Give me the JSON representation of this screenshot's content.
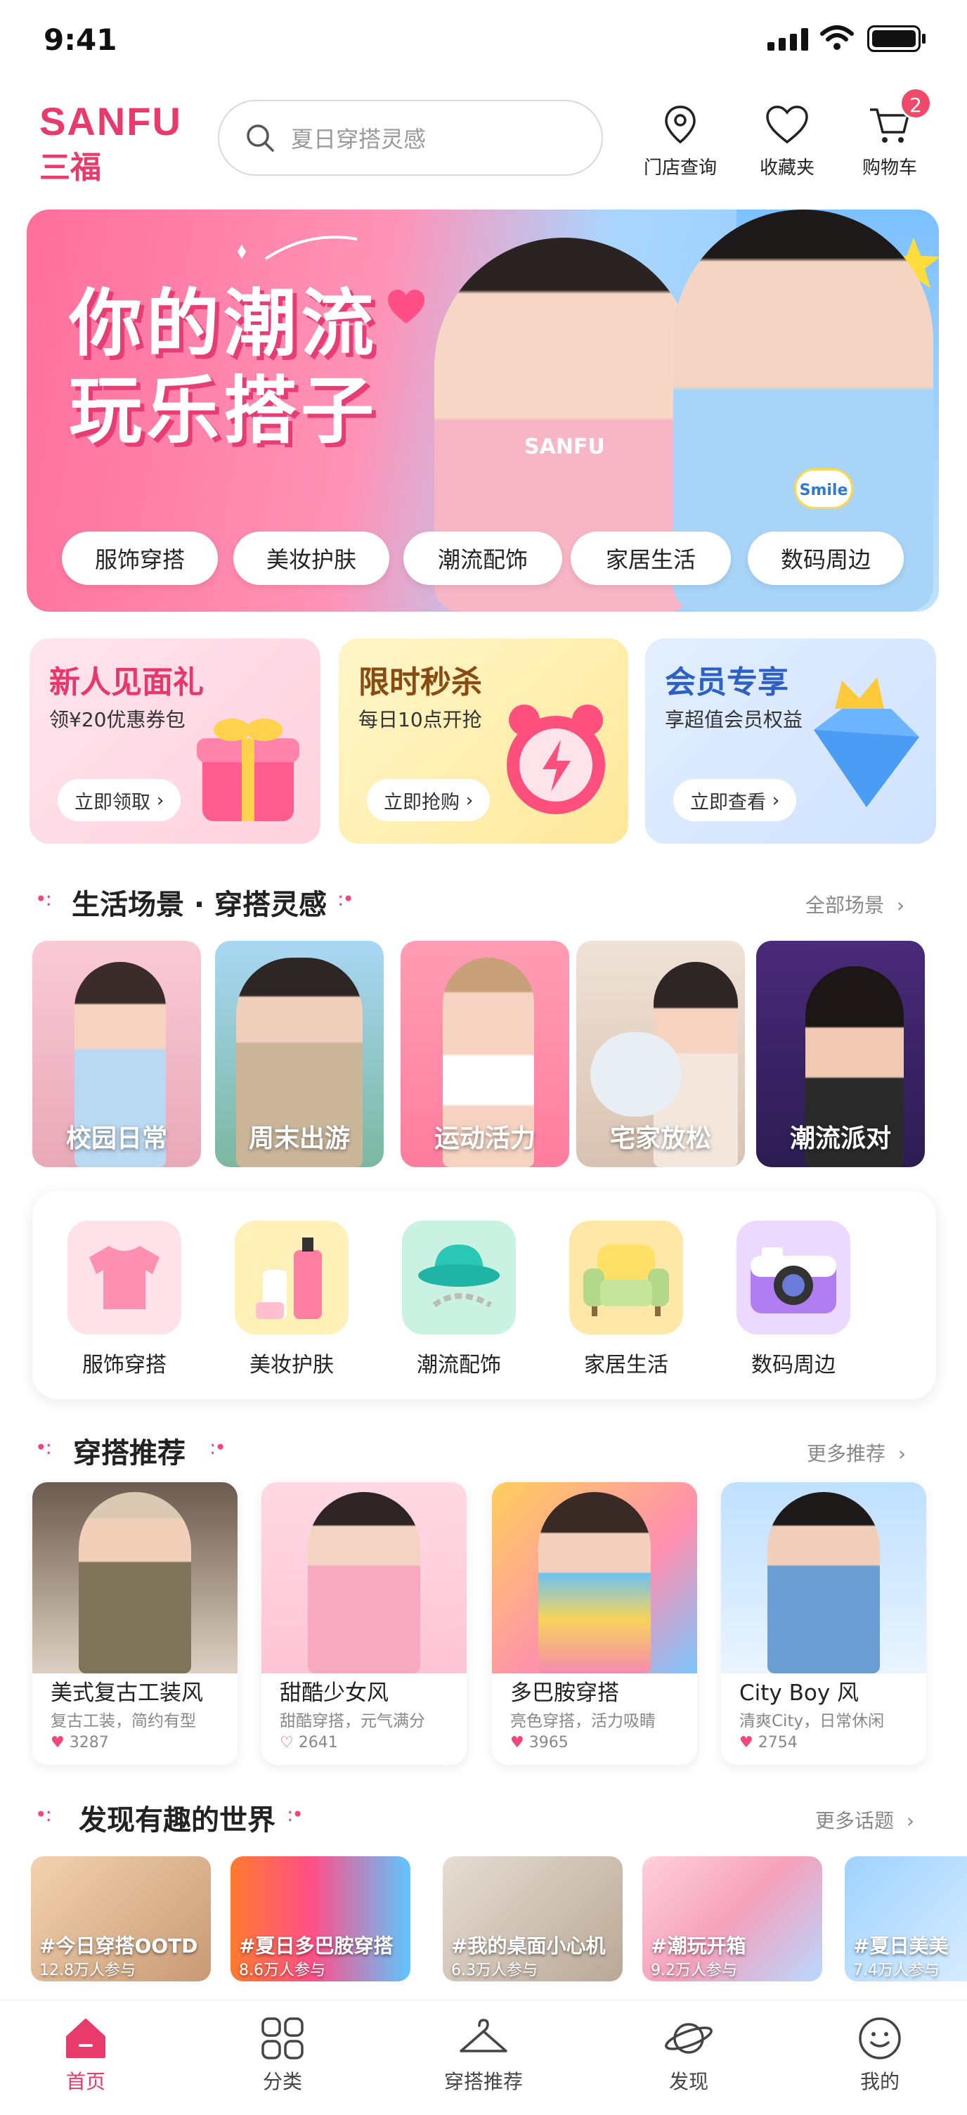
{
  "status": {
    "time": "9:41"
  },
  "header": {
    "logo_en": "SANFU",
    "logo_cn": "三福",
    "search_placeholder": "夏日穿搭灵感",
    "actions": [
      {
        "label": "门店查询",
        "icon": "location-pin-icon"
      },
      {
        "label": "收藏夹",
        "icon": "heart-icon"
      },
      {
        "label": "购物车",
        "icon": "cart-icon",
        "badge": "2"
      }
    ]
  },
  "banner": {
    "title_line1": "你的潮流",
    "title_line2": "玩乐搭子",
    "shirt_text": "SANFU",
    "badge_text": "Smile",
    "pills": [
      "服饰穿搭",
      "美妆护肤",
      "潮流配饰",
      "家居生活",
      "数码周边"
    ]
  },
  "promos": [
    {
      "title": "新人见面礼",
      "subtitle": "领¥20优惠券包",
      "button": "立即领取",
      "color": "#e8376a"
    },
    {
      "title": "限时秒杀",
      "subtitle": "每日10点开抢",
      "button": "立即抢购",
      "color": "#8a4b12"
    },
    {
      "title": "会员专享",
      "subtitle": "享超值会员权益",
      "button": "立即查看",
      "color": "#2d5fc4"
    }
  ],
  "scenes": {
    "title": "生活场景 · 穿搭灵感",
    "more": "全部场景",
    "items": [
      "校园日常",
      "周末出游",
      "运动活力",
      "宅家放松",
      "潮流派对"
    ]
  },
  "categories": [
    "服饰穿搭",
    "美妆护肤",
    "潮流配饰",
    "家居生活",
    "数码周边"
  ],
  "recommend": {
    "title": "穿搭推荐",
    "more": "更多推荐",
    "items": [
      {
        "title": "美式复古工装风",
        "desc": "复古工装，简约有型",
        "likes": "3287"
      },
      {
        "title": "甜酷少女风",
        "desc": "甜酷穿搭，元气满分",
        "likes": "2641"
      },
      {
        "title": "多巴胺穿搭",
        "desc": "亮色穿搭，活力吸睛",
        "likes": "3965"
      },
      {
        "title": "City Boy 风",
        "desc": "清爽City，日常休闲",
        "likes": "2754"
      }
    ]
  },
  "discover": {
    "title": "发现有趣的世界",
    "more": "更多话题",
    "items": [
      {
        "tag": "#今日穿搭OOTD",
        "count": "12.8万人参与"
      },
      {
        "tag": "#夏日多巴胺穿搭",
        "count": "8.6万人参与"
      },
      {
        "tag": "#我的桌面小心机",
        "count": "6.3万人参与"
      },
      {
        "tag": "#潮玩开箱",
        "count": "9.2万人参与"
      },
      {
        "tag": "#夏日美美",
        "count": "7.4万人参与"
      }
    ]
  },
  "tabs": [
    {
      "label": "首页",
      "active": true
    },
    {
      "label": "分类",
      "active": false
    },
    {
      "label": "穿搭推荐",
      "active": false
    },
    {
      "label": "发现",
      "active": false
    },
    {
      "label": "我的",
      "active": false
    }
  ],
  "colors": {
    "brand": "#e83a6b",
    "accent_pink": "#f0467a"
  }
}
